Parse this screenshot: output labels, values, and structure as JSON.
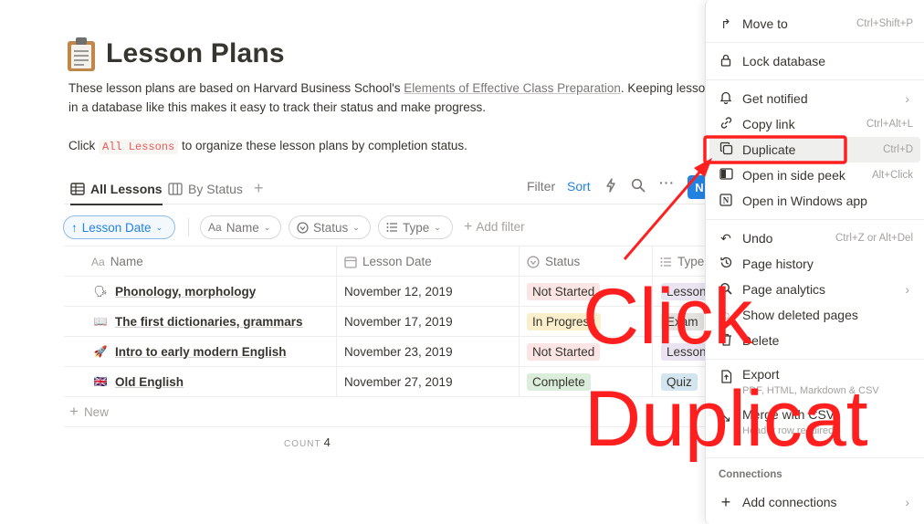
{
  "page": {
    "title": "Lesson Plans",
    "desc_line1_pre": "These lesson plans are based on Harvard Business School's ",
    "desc_link": "Elements of Effective Class Preparation",
    "desc_line1_post": ". Keeping lesso",
    "desc_line2": "in a database like this makes it easy to track their status and make progress.",
    "desc_line3_pre": "Click ",
    "desc_code": "All Lessons",
    "desc_line3_post": " to organize these lesson plans by completion status."
  },
  "views": {
    "tab_all": "All Lessons",
    "tab_status": "By Status",
    "add": "+",
    "filter": "Filter",
    "sort": "Sort",
    "new_letter": "N"
  },
  "filters": {
    "sort_chip": "Lesson Date",
    "name_chip": "Name",
    "status_chip": "Status",
    "type_chip": "Type",
    "add_filter": "Add filter"
  },
  "table": {
    "headers": {
      "name": "Name",
      "date": "Lesson Date",
      "status": "Status",
      "type": "Type"
    },
    "rows": [
      {
        "emoji": "🗣",
        "name": "Phonology, morphology",
        "date": "November 12, 2019",
        "status": "Not Started",
        "type": "Lesson"
      },
      {
        "emoji": "📖",
        "name": "The first dictionaries, grammars",
        "date": "November 17, 2019",
        "status": "In Progress",
        "type": "Exam"
      },
      {
        "emoji": "🚀",
        "name": "Intro to early modern English",
        "date": "November 23, 2019",
        "status": "Not Started",
        "type": "Lesson"
      },
      {
        "emoji": "🇬🇧",
        "name": "Old English",
        "date": "November 27, 2019",
        "status": "Complete",
        "type": "Quiz"
      }
    ],
    "new_label": "New",
    "count_label": "COUNT",
    "count_value": "4"
  },
  "menu": {
    "move_to": {
      "label": "Move to",
      "shortcut": "Ctrl+Shift+P"
    },
    "lock": {
      "label": "Lock database"
    },
    "notified": {
      "label": "Get notified"
    },
    "copy_link": {
      "label": "Copy link",
      "shortcut": "Ctrl+Alt+L"
    },
    "duplicate": {
      "label": "Duplicate",
      "shortcut": "Ctrl+D"
    },
    "side_peek": {
      "label": "Open in side peek",
      "shortcut": "Alt+Click"
    },
    "windows_app": {
      "label": "Open in Windows app"
    },
    "undo": {
      "label": "Undo",
      "shortcut": "Ctrl+Z or Alt+Del"
    },
    "history": {
      "label": "Page history"
    },
    "analytics": {
      "label": "Page analytics"
    },
    "deleted": {
      "label": "Show deleted pages"
    },
    "delete": {
      "label": "Delete"
    },
    "export": {
      "label": "Export",
      "sub": "PDF, HTML, Markdown & CSV"
    },
    "merge": {
      "label": "Merge with CSV",
      "sub": "Header row required"
    },
    "connections_header": "Connections",
    "add_connections": {
      "label": "Add connections"
    }
  },
  "annotation": {
    "line1": "Click",
    "line2": "Duplicat",
    "color": "#ff1f1f"
  },
  "colors": {
    "accent": "#2383e2",
    "not_started_bg": "#fbe4e4",
    "in_progress_bg": "#fbeecb",
    "complete_bg": "#dbeddb",
    "lesson_bg": "#eae4f2",
    "exam_bg": "#e3e2e0",
    "quiz_bg": "#d3e5ef"
  },
  "icons": [
    "clipboard-icon",
    "table-icon",
    "board-icon",
    "lightning-icon",
    "search-icon",
    "more-icon",
    "arrow-up-icon",
    "text-icon",
    "status-icon",
    "list-icon",
    "calendar-icon",
    "move-icon",
    "lock-icon",
    "bell-icon",
    "link-icon",
    "duplicate-icon",
    "sidebar-icon",
    "notion-icon",
    "undo-icon",
    "history-icon",
    "analytics-icon",
    "trash-icon",
    "export-icon",
    "merge-icon",
    "plus-icon",
    "chevron-right-icon"
  ]
}
